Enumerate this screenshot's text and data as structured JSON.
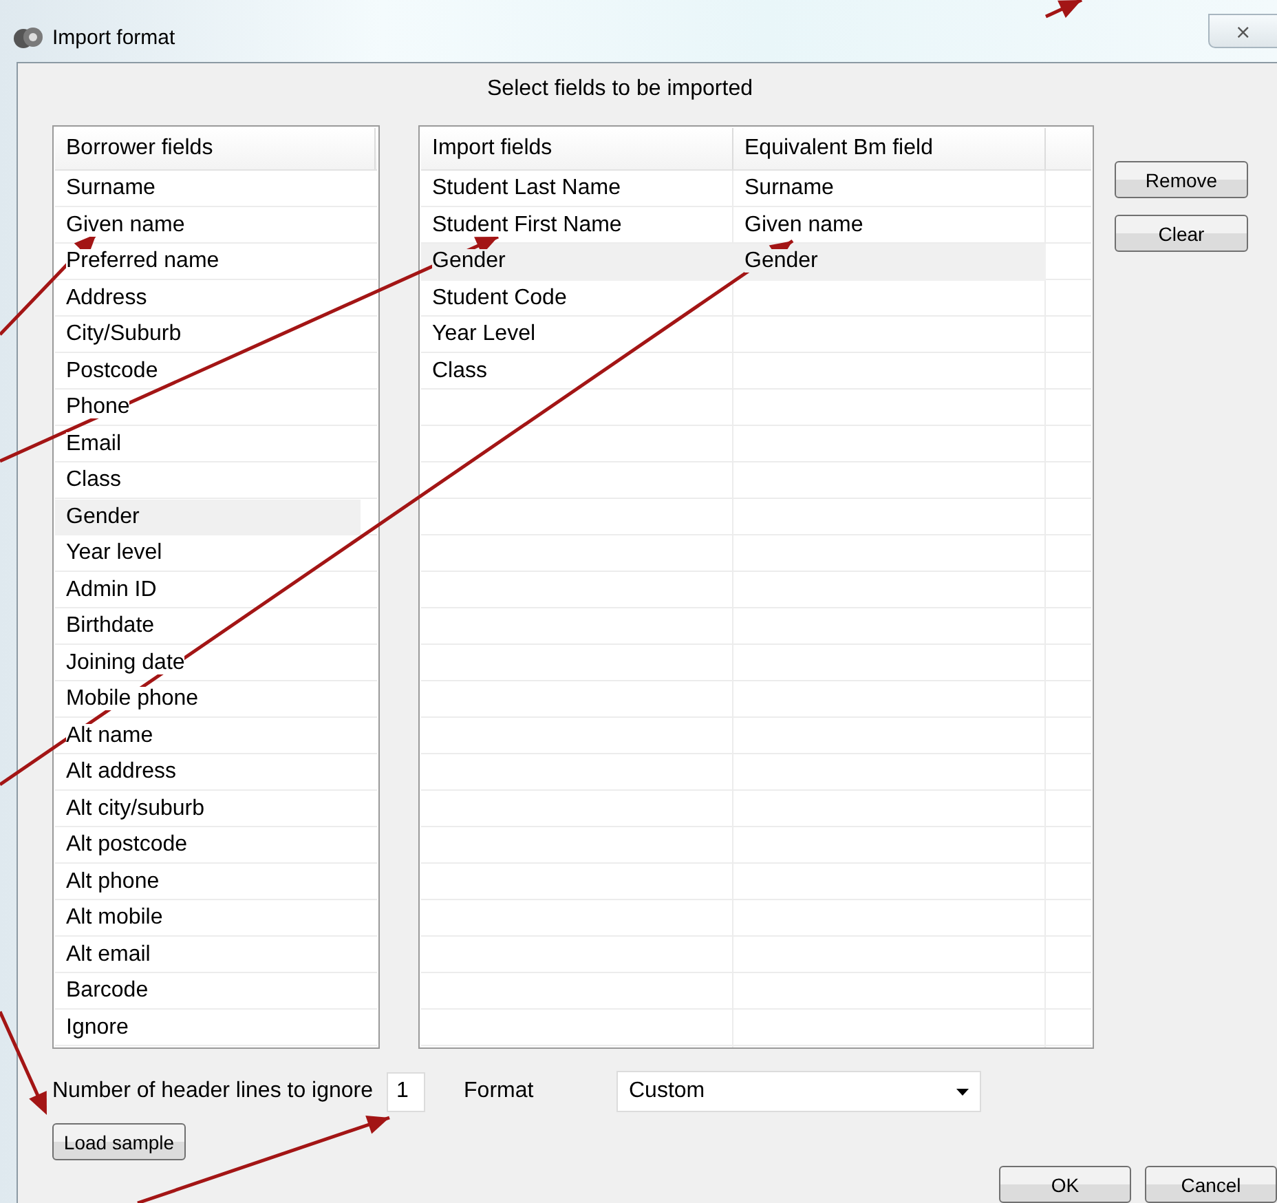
{
  "window": {
    "title": "Import format",
    "close": "⨯"
  },
  "heading": "Select fields to be imported",
  "borrower_list": {
    "header": "Borrower fields",
    "items": [
      {
        "label": "Surname",
        "selected": false
      },
      {
        "label": "Given name",
        "selected": false
      },
      {
        "label": "Preferred name",
        "selected": false
      },
      {
        "label": "Address",
        "selected": false
      },
      {
        "label": "City/Suburb",
        "selected": false
      },
      {
        "label": "Postcode",
        "selected": false
      },
      {
        "label": "Phone",
        "selected": false
      },
      {
        "label": "Email",
        "selected": false
      },
      {
        "label": "Class",
        "selected": false
      },
      {
        "label": "Gender",
        "selected": true
      },
      {
        "label": "Year level",
        "selected": false
      },
      {
        "label": "Admin ID",
        "selected": false
      },
      {
        "label": "Birthdate",
        "selected": false
      },
      {
        "label": "Joining date",
        "selected": false
      },
      {
        "label": "Mobile phone",
        "selected": false
      },
      {
        "label": "Alt name",
        "selected": false
      },
      {
        "label": "Alt address",
        "selected": false
      },
      {
        "label": "Alt city/suburb",
        "selected": false
      },
      {
        "label": "Alt postcode",
        "selected": false
      },
      {
        "label": "Alt phone",
        "selected": false
      },
      {
        "label": "Alt mobile",
        "selected": false
      },
      {
        "label": "Alt email",
        "selected": false
      },
      {
        "label": "Barcode",
        "selected": false
      },
      {
        "label": "Ignore",
        "selected": false
      }
    ]
  },
  "import_table": {
    "columns": [
      "Import fields",
      "Equivalent Bm field"
    ],
    "rows": [
      {
        "import_field": "Student Last Name",
        "equivalent": "Surname",
        "selected": false
      },
      {
        "import_field": "Student First Name",
        "equivalent": "Given name",
        "selected": false
      },
      {
        "import_field": "Gender",
        "equivalent": "Gender",
        "selected": true
      },
      {
        "import_field": "Student Code",
        "selected": false
      },
      {
        "import_field": "Year Level",
        "selected": false
      },
      {
        "import_field": "Class",
        "selected": false
      }
    ]
  },
  "side_buttons": [
    "Remove",
    "Clear"
  ],
  "header_lines": {
    "label": "Number of header lines to ignore",
    "value": "1"
  },
  "format": {
    "label": "Format",
    "value": "Custom"
  },
  "load_sample": "Load sample",
  "buttons": [
    "OK",
    "Cancel"
  ]
}
